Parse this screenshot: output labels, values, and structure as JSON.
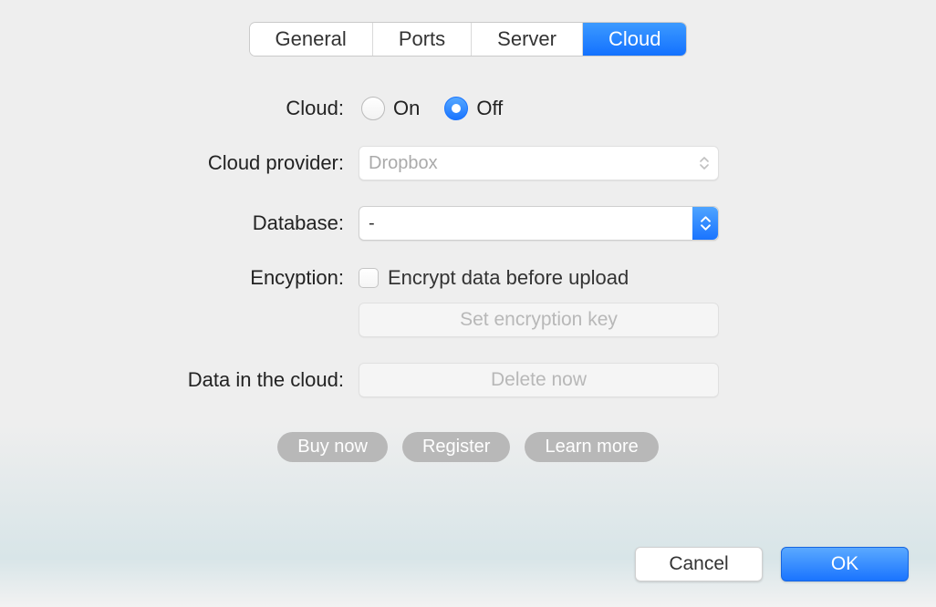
{
  "tabs": [
    {
      "label": "General",
      "selected": false
    },
    {
      "label": "Ports",
      "selected": false
    },
    {
      "label": "Server",
      "selected": false
    },
    {
      "label": "Cloud",
      "selected": true
    }
  ],
  "labels": {
    "cloud": "Cloud:",
    "cloud_provider": "Cloud provider:",
    "database": "Database:",
    "encryption": "Encyption:",
    "data_in_cloud": "Data in the cloud:"
  },
  "cloud_radio": {
    "on": "On",
    "off": "Off",
    "selected": "off"
  },
  "cloud_provider": {
    "value": "Dropbox",
    "disabled": true
  },
  "database": {
    "value": "-",
    "disabled": false
  },
  "encryption": {
    "label": "Encrypt data before upload",
    "checked": false
  },
  "buttons": {
    "set_key": "Set encryption key",
    "delete_now": "Delete now",
    "buy_now": "Buy now",
    "register": "Register",
    "learn_more": "Learn more",
    "cancel": "Cancel",
    "ok": "OK"
  }
}
